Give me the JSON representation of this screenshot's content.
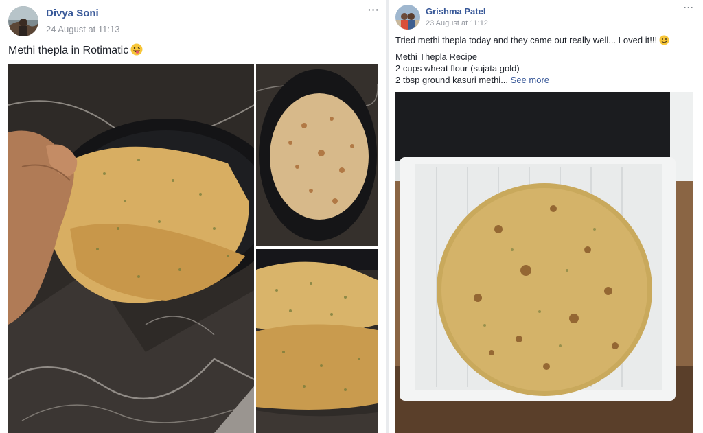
{
  "posts": [
    {
      "author": "Divya Soni",
      "timestamp": "24 August at 11:13",
      "text": "Methi thepla in Rotimatic",
      "more_label": "···",
      "emoji": "grinning-tongue-face"
    },
    {
      "author": "Grishma Patel",
      "timestamp": "23 August at 11:12",
      "text_line1": "Tried methi thepla today and they came out really well... Loved it!!!",
      "recipe_title": "Methi Thepla Recipe",
      "recipe_line1": "2 cups wheat flour (sujata gold)",
      "recipe_line2": "2 tbsp ground kasuri methi...",
      "see_more": "See more",
      "more_label": "···",
      "emoji": "smiling-face"
    }
  ],
  "colors": {
    "link": "#385898",
    "meta": "#90949c",
    "divider": "#e9ebee"
  }
}
